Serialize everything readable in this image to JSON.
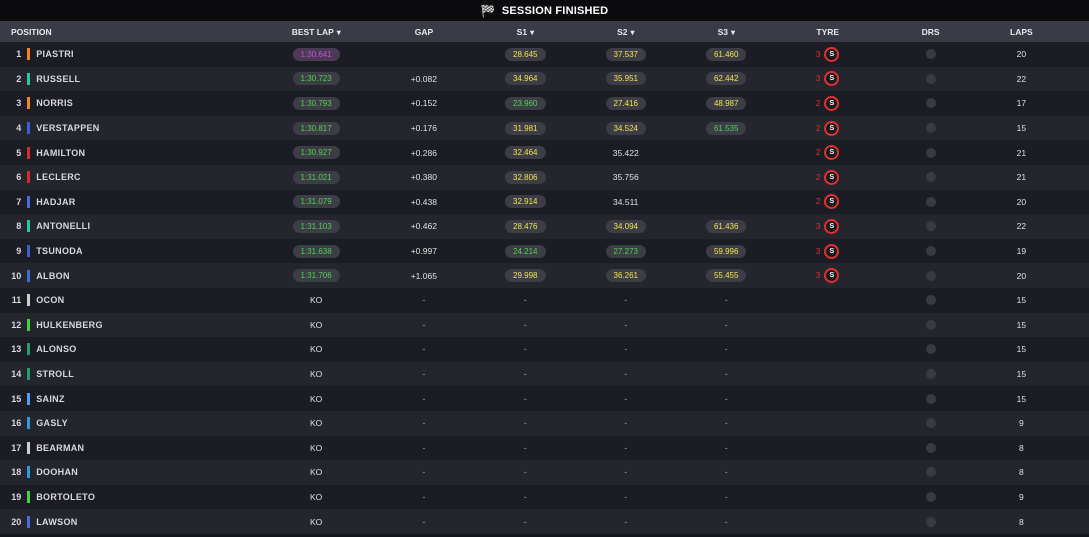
{
  "session": {
    "title": "SESSION FINISHED"
  },
  "columns": {
    "position": "POSITION",
    "best_lap": "BEST LAP",
    "gap": "GAP",
    "s1": "S1",
    "s2": "S2",
    "s3": "S3",
    "tyre": "TYRE",
    "drs": "DRS",
    "laps": "LAPS"
  },
  "colors": {
    "sector_green": "#4fd24f",
    "sector_yellow": "#f2e44a",
    "sector_purple": "#c44fd6",
    "soft_tyre": "#e23030"
  },
  "rows": [
    {
      "pos": "1",
      "driver": "PIASTRI",
      "team": "#f0861e",
      "best": "1:30.641",
      "best_c": "purple",
      "gap": "",
      "s1": "28.645",
      "s1_c": "yellow",
      "s2": "37.537",
      "s2_c": "yellow",
      "s3": "61.460",
      "s3_c": "yellow",
      "tyre_age": "3",
      "tyre": "S",
      "laps": "20"
    },
    {
      "pos": "2",
      "driver": "RUSSELL",
      "team": "#27c7a2",
      "best": "1:30.723",
      "best_c": "green",
      "gap": "+0.082",
      "s1": "34.964",
      "s1_c": "yellow",
      "s2": "35.951",
      "s2_c": "yellow",
      "s3": "62.442",
      "s3_c": "yellow",
      "tyre_age": "3",
      "tyre": "S",
      "laps": "22"
    },
    {
      "pos": "3",
      "driver": "NORRIS",
      "team": "#f0861e",
      "best": "1:30.793",
      "best_c": "green",
      "gap": "+0.152",
      "s1": "23.960",
      "s1_c": "green",
      "s2": "27.416",
      "s2_c": "yellow",
      "s3": "48.987",
      "s3_c": "yellow",
      "tyre_age": "2",
      "tyre": "S",
      "laps": "17"
    },
    {
      "pos": "4",
      "driver": "VERSTAPPEN",
      "team": "#3a5fcf",
      "best": "1:30.817",
      "best_c": "green",
      "gap": "+0.176",
      "s1": "31.981",
      "s1_c": "yellow",
      "s2": "34.524",
      "s2_c": "yellow",
      "s3": "61.535",
      "s3_c": "green",
      "tyre_age": "2",
      "tyre": "S",
      "laps": "15"
    },
    {
      "pos": "5",
      "driver": "HAMILTON",
      "team": "#d82a2a",
      "best": "1:30.927",
      "best_c": "green",
      "gap": "+0.286",
      "s1": "32.464",
      "s1_c": "yellow",
      "s2": "35.422",
      "s2_c": "white",
      "s3": "",
      "s3_c": "",
      "tyre_age": "2",
      "tyre": "S",
      "laps": "21"
    },
    {
      "pos": "6",
      "driver": "LECLERC",
      "team": "#d82a2a",
      "best": "1:31.021",
      "best_c": "green",
      "gap": "+0.380",
      "s1": "32.806",
      "s1_c": "yellow",
      "s2": "35.756",
      "s2_c": "white",
      "s3": "",
      "s3_c": "",
      "tyre_age": "2",
      "tyre": "S",
      "laps": "21"
    },
    {
      "pos": "7",
      "driver": "HADJAR",
      "team": "#4a6be0",
      "best": "1:31.079",
      "best_c": "green",
      "gap": "+0.438",
      "s1": "32.914",
      "s1_c": "yellow",
      "s2": "34.511",
      "s2_c": "white",
      "s3": "",
      "s3_c": "",
      "tyre_age": "2",
      "tyre": "S",
      "laps": "20"
    },
    {
      "pos": "8",
      "driver": "ANTONELLI",
      "team": "#27c7a2",
      "best": "1:31.103",
      "best_c": "green",
      "gap": "+0.462",
      "s1": "28.476",
      "s1_c": "yellow",
      "s2": "34.094",
      "s2_c": "yellow",
      "s3": "61.436",
      "s3_c": "yellow",
      "tyre_age": "3",
      "tyre": "S",
      "laps": "22"
    },
    {
      "pos": "9",
      "driver": "TSUNODA",
      "team": "#3a5fcf",
      "best": "1:31.638",
      "best_c": "green",
      "gap": "+0.997",
      "s1": "24.214",
      "s1_c": "green",
      "s2": "27.273",
      "s2_c": "green",
      "s3": "59.996",
      "s3_c": "yellow",
      "tyre_age": "3",
      "tyre": "S",
      "laps": "19"
    },
    {
      "pos": "10",
      "driver": "ALBON",
      "team": "#3a6ed6",
      "best": "1:31.706",
      "best_c": "green",
      "gap": "+1.065",
      "s1": "29.998",
      "s1_c": "yellow",
      "s2": "36.261",
      "s2_c": "yellow",
      "s3": "55.455",
      "s3_c": "yellow",
      "tyre_age": "3",
      "tyre": "S",
      "laps": "20"
    },
    {
      "pos": "11",
      "driver": "OCON",
      "team": "#cfcfcf",
      "best": "KO",
      "gap": "-",
      "s1": "-",
      "s2": "-",
      "s3": "-",
      "laps": "15"
    },
    {
      "pos": "12",
      "driver": "HULKENBERG",
      "team": "#3fd33f",
      "best": "KO",
      "gap": "-",
      "s1": "-",
      "s2": "-",
      "s3": "-",
      "laps": "15"
    },
    {
      "pos": "13",
      "driver": "ALONSO",
      "team": "#1f9e6a",
      "best": "KO",
      "gap": "-",
      "s1": "-",
      "s2": "-",
      "s3": "-",
      "laps": "15"
    },
    {
      "pos": "14",
      "driver": "STROLL",
      "team": "#1f9e6a",
      "best": "KO",
      "gap": "-",
      "s1": "-",
      "s2": "-",
      "s3": "-",
      "laps": "15"
    },
    {
      "pos": "15",
      "driver": "SAINZ",
      "team": "#4f9ef0",
      "best": "KO",
      "gap": "-",
      "s1": "-",
      "s2": "-",
      "s3": "-",
      "laps": "15"
    },
    {
      "pos": "16",
      "driver": "GASLY",
      "team": "#2f9bd8",
      "best": "KO",
      "gap": "-",
      "s1": "-",
      "s2": "-",
      "s3": "-",
      "laps": "9"
    },
    {
      "pos": "17",
      "driver": "BEARMAN",
      "team": "#cfcfcf",
      "best": "KO",
      "gap": "-",
      "s1": "-",
      "s2": "-",
      "s3": "-",
      "laps": "8"
    },
    {
      "pos": "18",
      "driver": "DOOHAN",
      "team": "#2f9bd8",
      "best": "KO",
      "gap": "-",
      "s1": "-",
      "s2": "-",
      "s3": "-",
      "laps": "8"
    },
    {
      "pos": "19",
      "driver": "BORTOLETO",
      "team": "#3fd33f",
      "best": "KO",
      "gap": "-",
      "s1": "-",
      "s2": "-",
      "s3": "-",
      "laps": "9"
    },
    {
      "pos": "20",
      "driver": "LAWSON",
      "team": "#4a6be0",
      "best": "KO",
      "gap": "-",
      "s1": "-",
      "s2": "-",
      "s3": "-",
      "laps": "8"
    }
  ]
}
